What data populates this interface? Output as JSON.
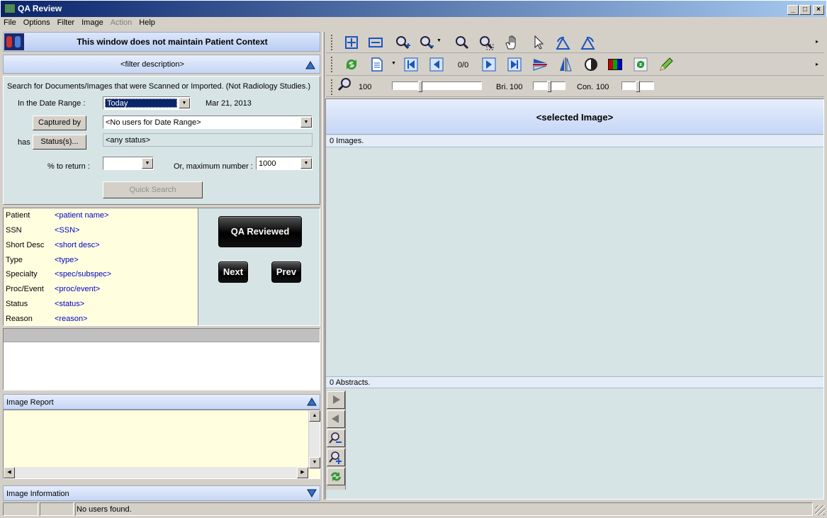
{
  "window": {
    "title": "QA Review"
  },
  "menu": [
    "File",
    "Options",
    "Filter",
    "Image",
    "Action",
    "Help"
  ],
  "menu_disabled": [
    "Action"
  ],
  "patient_context": {
    "text": "This window does not maintain Patient Context"
  },
  "filter": {
    "description": "<filter description>"
  },
  "search": {
    "heading": "Search for Documents/Images that were Scanned or Imported.  (Not Radiology Studies.)",
    "date_range_label": "In the Date Range :",
    "date_range_value": "Today",
    "date_value": "Mar 21, 2013",
    "captured_by_button": "Captured by",
    "captured_by_value": "<No users for Date Range>",
    "has_label": "has",
    "status_button": "Status(s)...",
    "status_value": "<any status>",
    "percent_label": "% to return :",
    "percent_value": "",
    "max_label": "Or,  maximum number :",
    "max_value": "1000",
    "quick_search_button": "Quick Search"
  },
  "details": {
    "rows": [
      {
        "label": "Patient",
        "value": "<patient name>"
      },
      {
        "label": "SSN",
        "value": "<SSN>"
      },
      {
        "label": "Short Desc",
        "value": "<short desc>"
      },
      {
        "label": "Type",
        "value": "<type>"
      },
      {
        "label": "Specialty",
        "value": "<spec/subspec>"
      },
      {
        "label": "Proc/Event",
        "value": "<proc/event>"
      },
      {
        "label": "Status",
        "value": "<status>"
      },
      {
        "label": "Reason",
        "value": "<reason>"
      }
    ],
    "qa_button": "QA Reviewed",
    "next_button": "Next",
    "prev_button": "Prev"
  },
  "image_report": {
    "title": "Image Report"
  },
  "image_information": {
    "title": "Image Information"
  },
  "viewer": {
    "zoom_value": "100",
    "bri_label": "Bri.",
    "bri_value": "100",
    "con_label": "Con.",
    "con_value": "100",
    "page_counter": "0/0",
    "selected_image": "<selected Image>",
    "images_count": "0 Images.",
    "abstracts_count": "0 Abstracts."
  },
  "status_bar": {
    "message": "No users found."
  },
  "colors": {
    "title_start": "#0a246a",
    "panel_bg": "#d4d0c8",
    "viewer_bg": "#d6e4e6",
    "detail_bg": "#ffffe0",
    "link_blue": "#0000c8"
  }
}
